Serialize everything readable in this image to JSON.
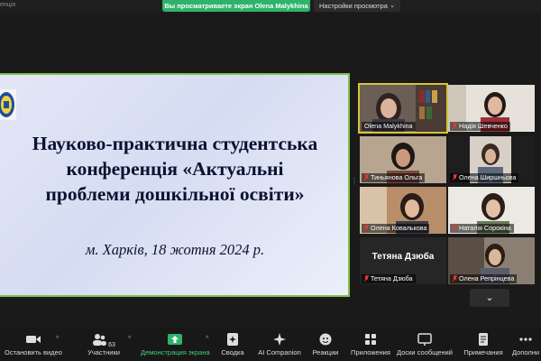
{
  "top_bar": {
    "left_fragment": "енція",
    "share_banner": "Вы просматриваете экран Olena Malykhina",
    "view_options": "Настройки просмотра"
  },
  "slide": {
    "title_line1": "Науково-практична студентська",
    "title_line2": "конференція «Актуальні",
    "title_line3": "проблеми дошкільної освіти»",
    "subtitle": "м. Харків,  18 жотня 2024 р."
  },
  "participants": [
    {
      "name": "Olena Malykhina",
      "active": true
    },
    {
      "name": "Надія Шевченко"
    },
    {
      "name": "Тиньянова Ольга"
    },
    {
      "name": "Олена Ширшньова"
    },
    {
      "name": "Олена Ковалькова"
    },
    {
      "name": "Наталія Сорокіна"
    },
    {
      "name": "Тетяна Дзюба",
      "card_text": "Тетяна Дзюба"
    },
    {
      "name": "Олена Репрінцева"
    }
  ],
  "toolbar": {
    "stop_video": "Остановить видео",
    "participants": "Участники",
    "participants_count": "63",
    "share_screen": "Демонстрация экрана",
    "summary": "Сводка",
    "ai_companion": "AI Companion",
    "reactions": "Реакции",
    "apps": "Приложения",
    "whiteboards": "Доски сообщений",
    "notes": "Примечания",
    "more": "Дополни"
  },
  "colors": {
    "accent_green": "#2fb36b",
    "active_speaker": "#d8c23a",
    "slide_border": "#7fc24c"
  }
}
